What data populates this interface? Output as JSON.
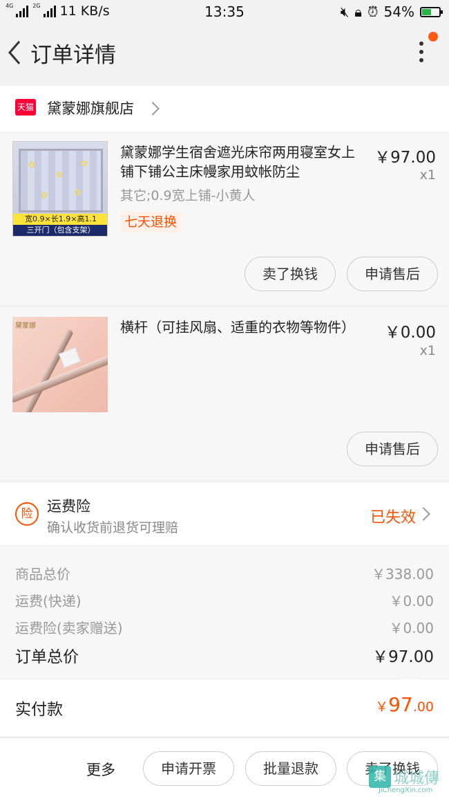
{
  "status_bar": {
    "net_small_1": "4G",
    "net_small_2": "2G",
    "speed": "11 KB/s",
    "time": "13:35",
    "battery": "54%",
    "battery_level": 0.54
  },
  "header": {
    "title": "订单详情"
  },
  "shop": {
    "badge": "天猫",
    "name": "黛蒙娜旗舰店"
  },
  "items": [
    {
      "name": "黛蒙娜学生宿舍遮光床帘两用寝室女上铺下铺公主床幔家用蚊帐防尘",
      "price": "￥97.00",
      "qty": "x1",
      "sku": "其它;0.9宽上铺-小黄人",
      "tag": "七天退换",
      "thumb_band": "宽0.9×长1.9×高1.1",
      "thumb_band2": "三开门（包含支架）",
      "buttons": [
        "卖了换钱",
        "申请售后"
      ]
    },
    {
      "name": "横杆（可挂风扇、适重的衣物等物件）",
      "price": "￥0.00",
      "qty": "x1",
      "thumb_logo": "黛蒙娜",
      "buttons": [
        "申请售后"
      ]
    }
  ],
  "insurance": {
    "icon": "险",
    "title": "运费险",
    "desc": "确认收货前退货可理赔",
    "status": "已失效"
  },
  "summary": {
    "goods_label": "商品总价",
    "goods_value": "￥338.00",
    "shipping_label": "运费(快递)",
    "shipping_value": "￥0.00",
    "ins_label": "运费险(卖家赠送)",
    "ins_value": "￥0.00",
    "total_label": "订单总价",
    "total_value": "￥97.00"
  },
  "paid": {
    "label": "实付款",
    "currency": "￥",
    "integer": "97",
    "decimal": ".00"
  },
  "bottom_bar": {
    "more": "更多",
    "buttons": [
      "申请开票",
      "批量退款",
      "卖了换钱"
    ]
  },
  "watermark": {
    "mark": "集",
    "text": "城城傳",
    "url": "JiChengXin.com"
  },
  "colors": {
    "accent": "#ff5000",
    "tmall_red": "#ff0036",
    "notify_dot": "#ff5b14"
  }
}
